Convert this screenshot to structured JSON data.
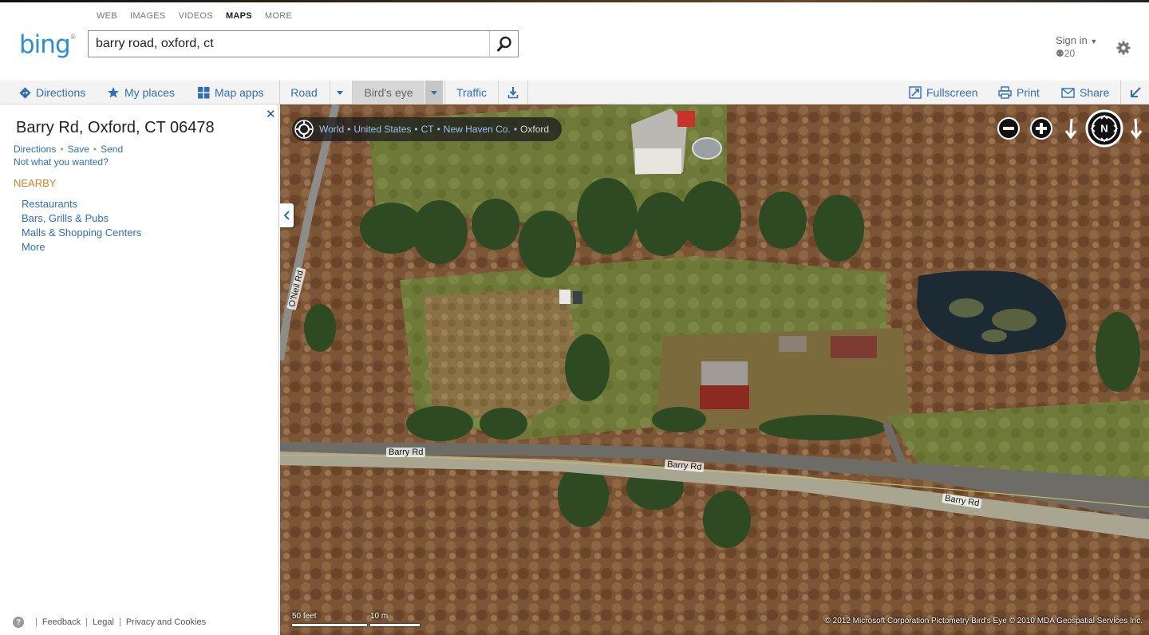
{
  "verticals": [
    {
      "label": "WEB",
      "active": false
    },
    {
      "label": "IMAGES",
      "active": false
    },
    {
      "label": "VIDEOS",
      "active": false
    },
    {
      "label": "MAPS",
      "active": true
    },
    {
      "label": "MORE",
      "active": false
    }
  ],
  "logo": {
    "text": "bing",
    "mark": "®"
  },
  "search": {
    "value": "barry road, oxford, ct",
    "button_icon": "search-icon"
  },
  "account": {
    "sign_in": "Sign in",
    "rewards_count": "20"
  },
  "toolbar": {
    "directions": "Directions",
    "my_places": "My places",
    "map_apps": "Map apps",
    "modes": {
      "road": "Road",
      "birds_eye": "Bird's eye",
      "traffic": "Traffic"
    },
    "fullscreen": "Fullscreen",
    "print": "Print",
    "share": "Share"
  },
  "panel": {
    "address": "Barry Rd, Oxford, CT 06478",
    "actions": {
      "directions": "Directions",
      "save": "Save",
      "send": "Send"
    },
    "not_wanted": "Not what you wanted?",
    "nearby_heading": "NEARBY",
    "nearby": [
      "Restaurants",
      "Bars, Grills & Pubs",
      "Malls & Shopping Centers",
      "More"
    ]
  },
  "footer": {
    "help": "?",
    "feedback": "Feedback",
    "legal": "Legal",
    "privacy": "Privacy and Cookies"
  },
  "map": {
    "breadcrumb": [
      "World",
      "United States",
      "CT",
      "New Haven Co.",
      "Oxford"
    ],
    "road_labels": {
      "oneil": "O'Neil Rd",
      "barry1": "Barry Rd",
      "barry2": "Barry Rd",
      "barry3": "Barry Rd"
    },
    "scale": {
      "feet": "50 feet",
      "meters": "10 m"
    },
    "copyright": "© 2012 Microsoft Corporation     Pictometry Bird's Eye © 2010 MDA Geospatial Services Inc."
  },
  "colors": {
    "accent": "#2f6fb8",
    "logo": "#2a8fd4",
    "nearby": "#d88026"
  }
}
